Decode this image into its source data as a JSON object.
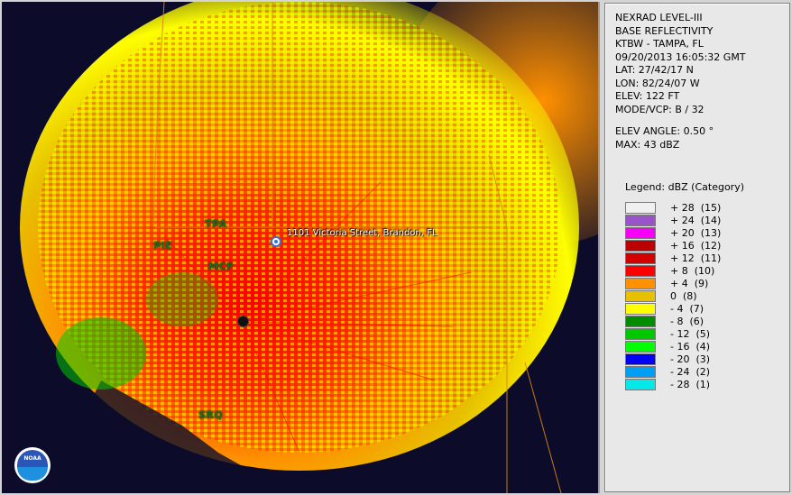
{
  "info": {
    "product": "NEXRAD LEVEL-III",
    "type": "BASE REFLECTIVITY",
    "station": "KTBW - TAMPA, FL",
    "datetime": "09/20/2013 16:05:32 GMT",
    "lat": "LAT: 27/42/17 N",
    "lon": "LON: 82/24/07 W",
    "elev": "ELEV: 122 FT",
    "mode": "MODE/VCP: B / 32",
    "elev_angle": "ELEV ANGLE: 0.50 °",
    "max": "MAX: 43 dBZ"
  },
  "legend": {
    "title": "Legend: dBZ (Category)",
    "items": [
      {
        "label": "+ 28  (15)",
        "color": "#f0f0f0"
      },
      {
        "label": "+ 24  (14)",
        "color": "#9954c8"
      },
      {
        "label": "+ 20  (13)",
        "color": "#f800f8"
      },
      {
        "label": "+ 16  (12)",
        "color": "#bc0000"
      },
      {
        "label": "+ 12  (11)",
        "color": "#d40000"
      },
      {
        "label": "+ 8  (10)",
        "color": "#ff0000"
      },
      {
        "label": "+ 4  (9)",
        "color": "#ff9000"
      },
      {
        "label": "0  (8)",
        "color": "#e7c000"
      },
      {
        "label": "- 4  (7)",
        "color": "#ffff00"
      },
      {
        "label": "- 8  (6)",
        "color": "#008e00"
      },
      {
        "label": "- 12  (5)",
        "color": "#00c800"
      },
      {
        "label": "- 16  (4)",
        "color": "#00ff00"
      },
      {
        "label": "- 20  (3)",
        "color": "#0000f6"
      },
      {
        "label": "- 24  (2)",
        "color": "#019ff4"
      },
      {
        "label": "- 28  (1)",
        "color": "#04e9e7"
      }
    ]
  },
  "map": {
    "address": "1101 Victoria Street, Brandon, FL",
    "sites": [
      "TPA",
      "PIE",
      "MCF",
      "SRQ"
    ],
    "logo_text": "NOAA"
  }
}
